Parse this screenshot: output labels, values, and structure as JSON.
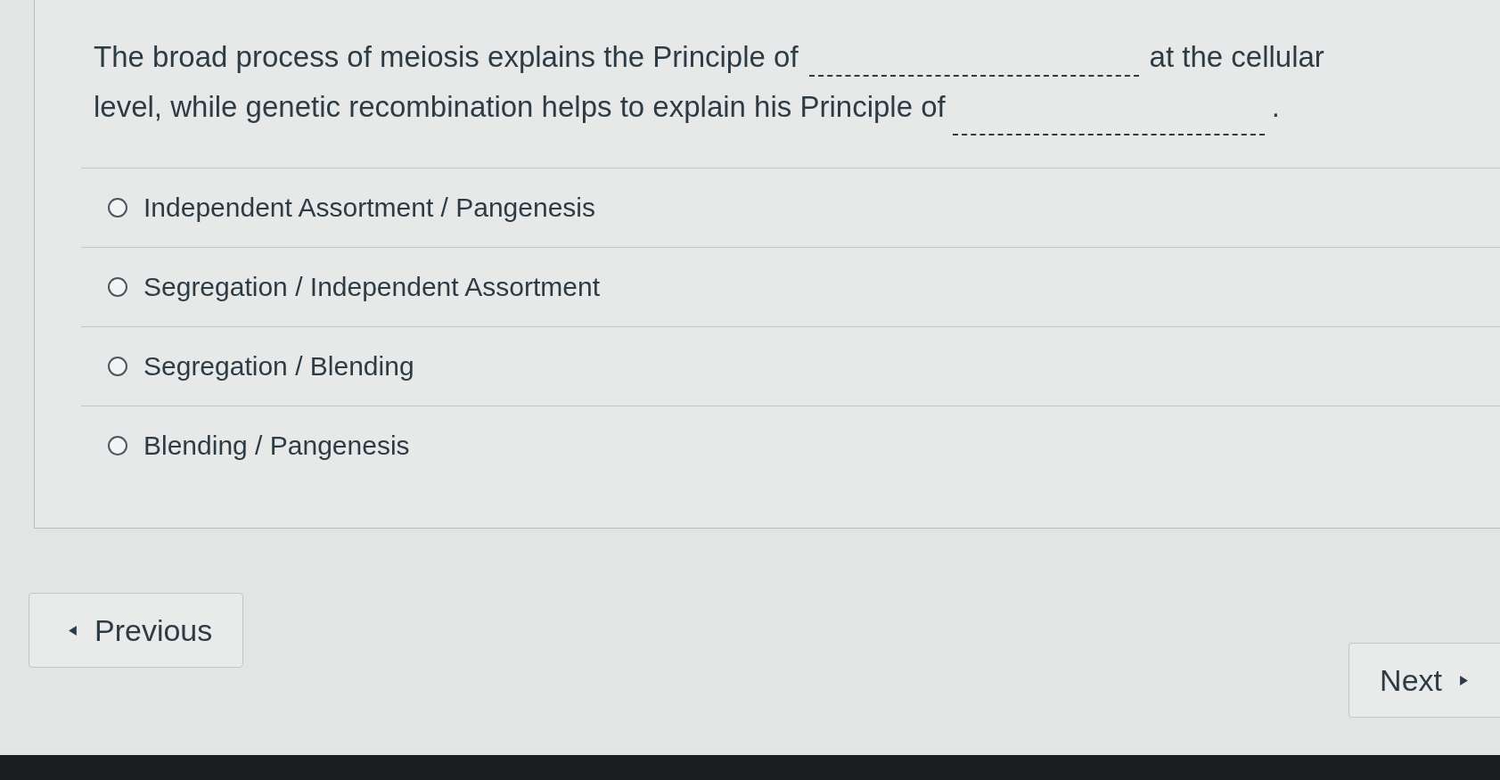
{
  "question": {
    "lines": [
      {
        "parts": [
          {
            "kind": "text",
            "text": "The broad process of meiosis explains the Principle of"
          },
          {
            "kind": "blank"
          },
          {
            "kind": "text",
            "text": "at the cellular"
          }
        ]
      },
      {
        "parts": [
          {
            "kind": "text",
            "text": "level, while genetic recombination helps to explain his Principle of"
          },
          {
            "kind": "blank"
          },
          {
            "kind": "text",
            "text": "."
          }
        ]
      }
    ]
  },
  "options": [
    {
      "label": "Independent Assortment / Pangenesis",
      "selected": false
    },
    {
      "label": "Segregation / Independent Assortment",
      "selected": false
    },
    {
      "label": "Segregation / Blending",
      "selected": false
    },
    {
      "label": "Blending / Pangenesis",
      "selected": false
    }
  ],
  "navigation": {
    "previous": {
      "label": "Previous"
    },
    "next": {
      "label": "Next"
    }
  }
}
